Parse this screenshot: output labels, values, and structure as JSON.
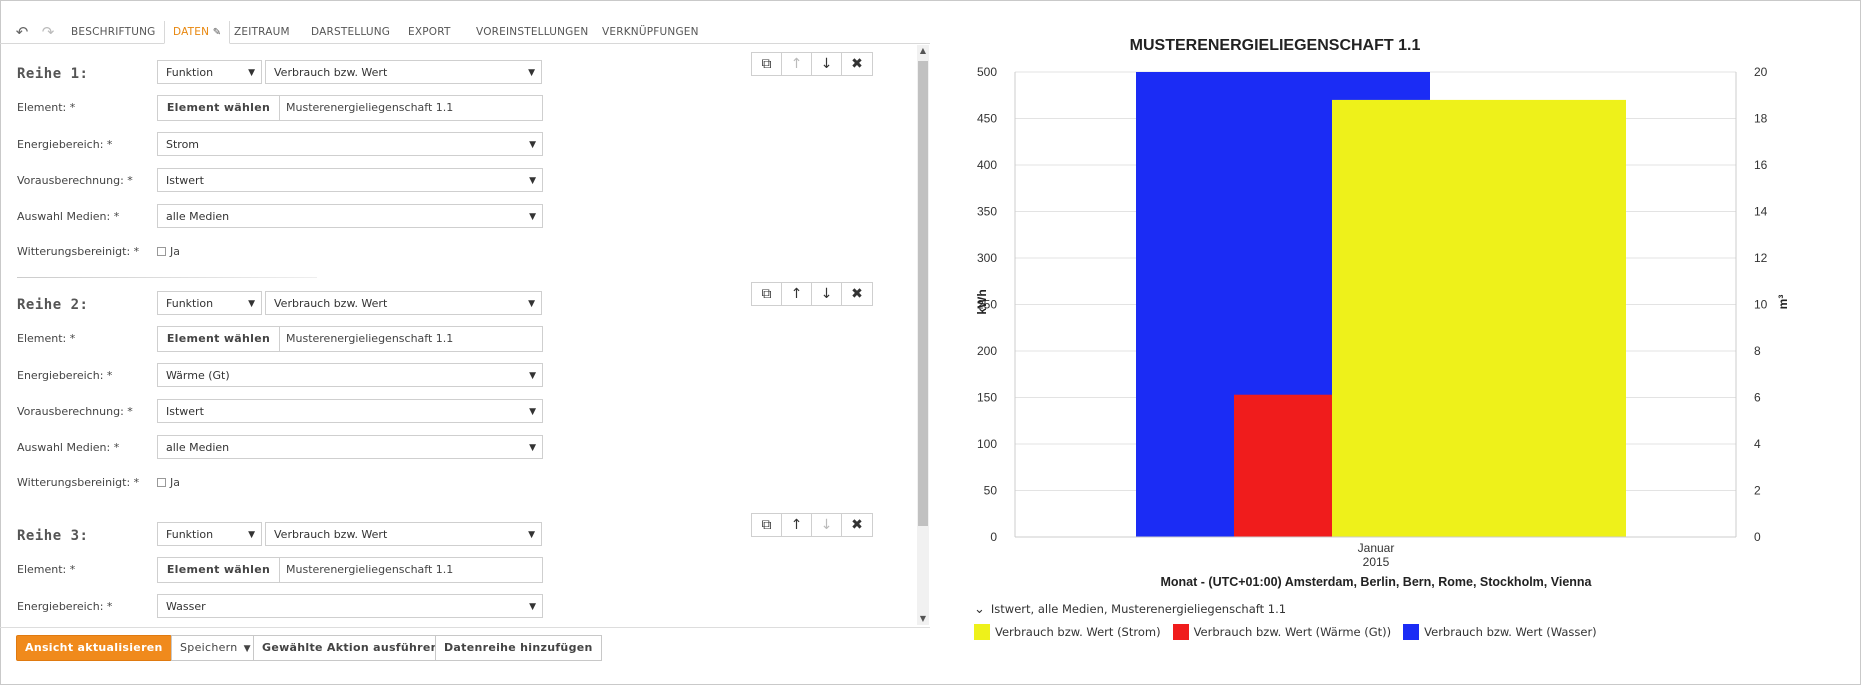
{
  "toolbar": {
    "undo_icon": "undo-icon",
    "redo_icon": "redo-icon",
    "tabs": [
      {
        "label": "BESCHRIFTUNG"
      },
      {
        "label": "DATEN"
      },
      {
        "label": "ZEITRAUM"
      },
      {
        "label": "DARSTELLUNG"
      },
      {
        "label": "EXPORT"
      },
      {
        "label": "VOREINSTELLUNGEN"
      },
      {
        "label": "VERKNÜPFUNGEN"
      }
    ],
    "active_tab": "DATEN",
    "edit_icon": "pencil-icon"
  },
  "labels": {
    "element": "Element: *",
    "energiebereich": "Energiebereich: *",
    "vorausberechnung": "Vorausberechnung: *",
    "auswahl_medien": "Auswahl Medien: *",
    "witterung": "Witterungsbereinigt: *",
    "element_button": "Element wählen",
    "checkbox_ja": "Ja"
  },
  "series": [
    {
      "title": "Reihe 1:",
      "type": "Funktion",
      "value": "Verbrauch bzw. Wert",
      "element": "Musterenergieliegenschaft 1.1",
      "energiebereich": "Strom",
      "vorausberechnung": "Istwert",
      "auswahl_medien": "alle Medien",
      "witterungsbereinigt": false
    },
    {
      "title": "Reihe 2:",
      "type": "Funktion",
      "value": "Verbrauch bzw. Wert",
      "element": "Musterenergieliegenschaft 1.1",
      "energiebereich": "Wärme (Gt)",
      "vorausberechnung": "Istwert",
      "auswahl_medien": "alle Medien",
      "witterungsbereinigt": false
    },
    {
      "title": "Reihe 3:",
      "type": "Funktion",
      "value": "Verbrauch bzw. Wert",
      "element": "Musterenergieliegenschaft 1.1",
      "energiebereich": "Wasser"
    }
  ],
  "row_controls": {
    "icons": [
      "copy-icon",
      "arrow-up-icon",
      "arrow-down-icon",
      "close-icon"
    ]
  },
  "actions": {
    "refresh": "Ansicht aktualisieren",
    "save": "Speichern",
    "run_action": "Gewählte Aktion ausführen",
    "add_series": "Datenreihe hinzufügen"
  },
  "colors": {
    "accent": "#e8870e",
    "strom": "#eef11a",
    "waerme": "#f01c1c",
    "wasser": "#1b2cf5"
  },
  "chart_data": {
    "type": "bar",
    "title": "MUSTERENERGIELIEGENSCHAFT 1.1",
    "xlabel": "Monat - (UTC+01:00) Amsterdam, Berlin, Bern, Rome, Stockholm, Vienna",
    "categories": [
      "Januar 2015"
    ],
    "category_lines": [
      "Januar",
      "2015"
    ],
    "y_left": {
      "label": "kWh",
      "min": 0,
      "max": 500,
      "ticks": [
        0,
        50,
        100,
        150,
        200,
        250,
        300,
        350,
        400,
        450,
        500
      ]
    },
    "y_right": {
      "label": "m³",
      "min": 0,
      "max": 20,
      "ticks": [
        0,
        2,
        4,
        6,
        8,
        10,
        12,
        14,
        16,
        18,
        20
      ]
    },
    "series": [
      {
        "name": "Verbrauch bzw. Wert (Wasser)",
        "axis": "right",
        "values": [
          20
        ],
        "color": "#1b2cf5"
      },
      {
        "name": "Verbrauch bzw. Wert (Wärme (Gt))",
        "axis": "left",
        "values": [
          153
        ],
        "color": "#f01c1c"
      },
      {
        "name": "Verbrauch bzw. Wert (Strom)",
        "axis": "left",
        "values": [
          470
        ],
        "color": "#eef11a"
      }
    ],
    "legend_title": "Istwert, alle Medien, Musterenergieliegenschaft 1.1",
    "legend_order": [
      "Verbrauch bzw. Wert (Strom)",
      "Verbrauch bzw. Wert (Wärme (Gt))",
      "Verbrauch bzw. Wert (Wasser)"
    ],
    "grid": true,
    "legend_position": "bottom-left"
  }
}
